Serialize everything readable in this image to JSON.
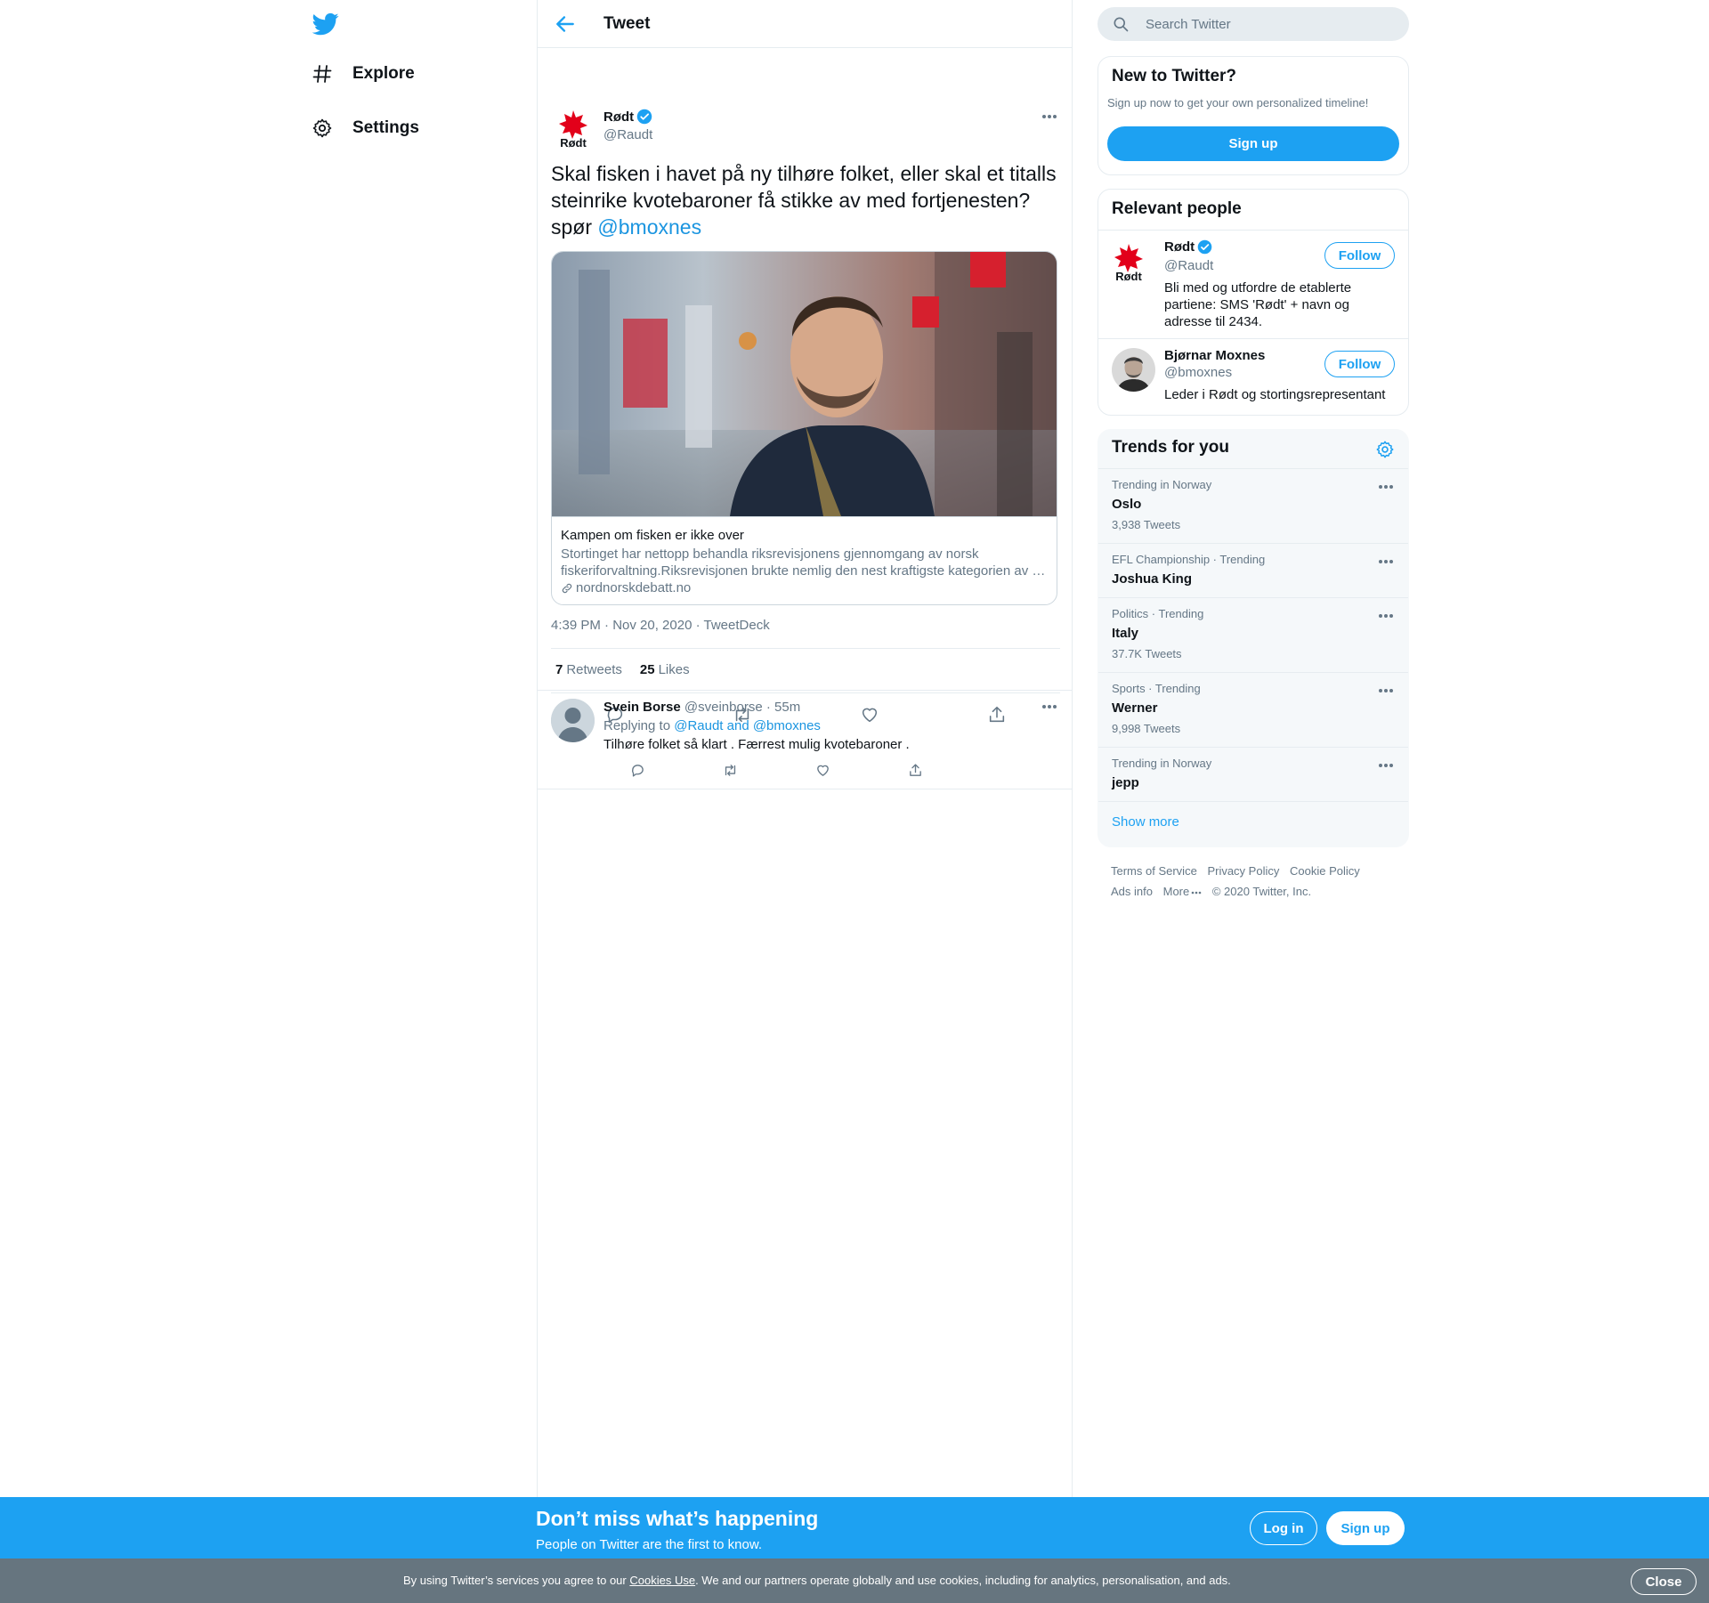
{
  "nav": {
    "items": [
      {
        "label": "Explore",
        "icon": "hashtag-icon"
      },
      {
        "label": "Settings",
        "icon": "gear-icon"
      }
    ]
  },
  "header": {
    "title": "Tweet"
  },
  "tweet": {
    "author_name": "Rødt",
    "author_handle": "@Raudt",
    "avatar_text": "Rødt",
    "text_before": "Skal fisken i havet på ny tilhøre folket, eller skal et titalls steinrike kvotebaroner få stikke av med fortjenesten? spør ",
    "mention": "@bmoxnes",
    "card": {
      "title": "Kampen om fisken er ikke over",
      "description": "Stortinget har nettopp behandla riksrevisjonens gjennomgang av norsk fiskeriforvaltning.Riksrevisjonen brukte nemlig den nest kraftigste kategorien av …",
      "domain": "nordnorskdebatt.no"
    },
    "time": "4:39 PM · Nov 20, 2020",
    "source": "TweetDeck",
    "retweets_count": "7",
    "retweets_label": "Retweets",
    "likes_count": "25",
    "likes_label": "Likes"
  },
  "reply": {
    "name": "Svein Borse",
    "handle": "@sveinborse",
    "time": "55m",
    "replying_prefix": "Replying to ",
    "replying_to": "@Raudt and @bmoxnes",
    "text": "Tilhøre folket så klart . Færrest mulig kvotebaroner ."
  },
  "search": {
    "placeholder": "Search Twitter"
  },
  "new_to_twitter": {
    "title": "New to Twitter?",
    "subtitle": "Sign up now to get your own personalized timeline!",
    "button": "Sign up"
  },
  "relevant_people": {
    "title": "Relevant people",
    "follow_label": "Follow",
    "people": [
      {
        "name": "Rødt",
        "handle": "@Raudt",
        "bio": "Bli med og utfordre de etablerte partiene: SMS 'Rødt' + navn og adresse til 2434."
      },
      {
        "name": "Bjørnar Moxnes",
        "handle": "@bmoxnes",
        "bio": "Leder i Rødt og stortingsrepresentant"
      }
    ]
  },
  "trends": {
    "title": "Trends for you",
    "items": [
      {
        "context": "Trending in Norway",
        "name": "Oslo",
        "count": "3,938 Tweets"
      },
      {
        "context": "EFL Championship · Trending",
        "name": "Joshua King",
        "count": ""
      },
      {
        "context": "Politics · Trending",
        "name": "Italy",
        "count": "37.7K Tweets"
      },
      {
        "context": "Sports · Trending",
        "name": "Werner",
        "count": "9,998 Tweets"
      },
      {
        "context": "Trending in Norway",
        "name": "jepp",
        "count": ""
      }
    ],
    "show_more": "Show more"
  },
  "footer": {
    "links": [
      "Terms of Service",
      "Privacy Policy",
      "Cookie Policy",
      "Ads info",
      "More"
    ],
    "copyright": "© 2020 Twitter, Inc."
  },
  "bottom_bar": {
    "headline": "Don’t miss what’s happening",
    "subline": "People on Twitter are the first to know.",
    "login": "Log in",
    "signup": "Sign up"
  },
  "cookie_bar": {
    "text_before": "By using Twitter’s services you agree to our ",
    "link": "Cookies Use",
    "text_after": ". We and our partners operate globally and use cookies, including for analytics, personalisation, and ads.",
    "close": "Close"
  },
  "colors": {
    "brand": "#1da1f2",
    "link": "#1b95e0",
    "secondary_text": "#657786",
    "rodt_red": "#e2001a"
  }
}
